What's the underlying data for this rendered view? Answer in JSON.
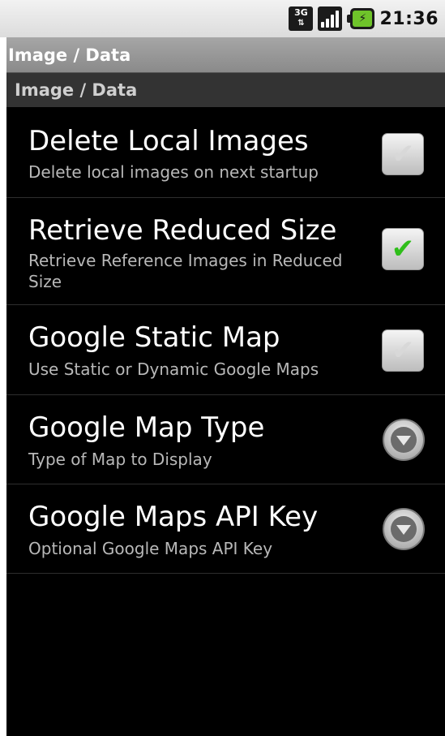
{
  "status_bar": {
    "network_type": "3G",
    "time": "21:36"
  },
  "window": {
    "title": "Image / Data"
  },
  "category": {
    "title": "Image / Data"
  },
  "preferences": [
    {
      "title": "Delete Local Images",
      "summary": "Delete local images on next startup",
      "widget": "checkbox",
      "checked": false
    },
    {
      "title": "Retrieve Reduced Size",
      "summary": "Retrieve Reference Images in Reduced Size",
      "widget": "checkbox",
      "checked": true
    },
    {
      "title": "Google Static Map",
      "summary": "Use Static or Dynamic Google Maps",
      "widget": "checkbox",
      "checked": false
    },
    {
      "title": "Google Map Type",
      "summary": "Type of Map to Display",
      "widget": "dropdown"
    },
    {
      "title": "Google Maps API Key",
      "summary": "Optional Google Maps API Key",
      "widget": "dropdown"
    }
  ],
  "colors": {
    "check_on": "#2fbe1a",
    "check_off": "#bdbdbd"
  }
}
